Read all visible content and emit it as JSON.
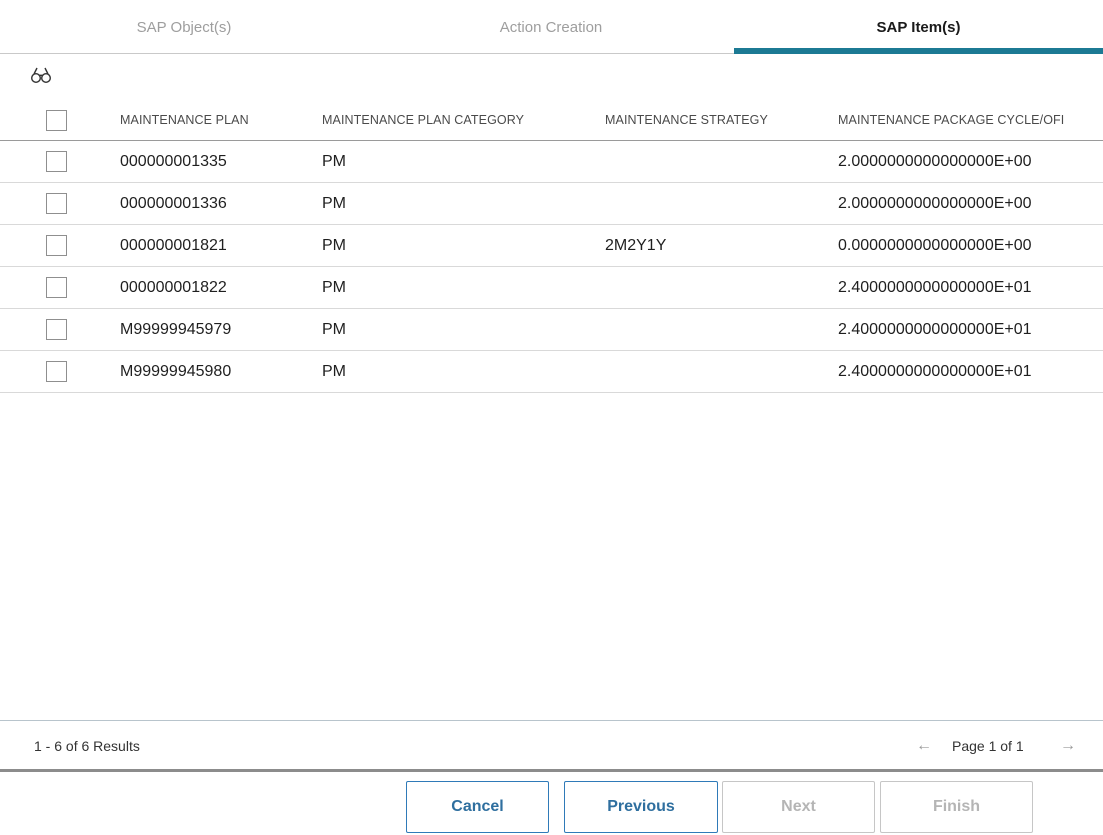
{
  "wizard": {
    "steps": [
      "SAP Object(s)",
      "Action Creation",
      "SAP Item(s)"
    ],
    "active_step": "SAP Item(s)"
  },
  "toolbar": {
    "find_icon": "binoculars-icon"
  },
  "grid": {
    "columns": [
      "MAINTENANCE PLAN",
      "MAINTENANCE PLAN CATEGORY",
      "MAINTENANCE STRATEGY",
      "MAINTENANCE PACKAGE CYCLE/OFI"
    ],
    "rows": [
      [
        "000000001335",
        "PM",
        "",
        "2.0000000000000000E+00"
      ],
      [
        "000000001336",
        "PM",
        "",
        "2.0000000000000000E+00"
      ],
      [
        "000000001821",
        "PM",
        "2M2Y1Y",
        "0.0000000000000000E+00"
      ],
      [
        "000000001822",
        "PM",
        "",
        "2.4000000000000000E+01"
      ],
      [
        "M99999945979",
        "PM",
        "",
        "2.4000000000000000E+01"
      ],
      [
        "M99999945980",
        "PM",
        "",
        "2.4000000000000000E+01"
      ]
    ]
  },
  "pager": {
    "results": "1 - 6 of 6 Results",
    "page_label": "Page 1 of 1",
    "prev_icon": "arrow-left-icon",
    "next_icon": "arrow-right-icon"
  },
  "buttons": {
    "cancel": "Cancel",
    "previous": "Previous",
    "next": "Next",
    "finish": "Finish"
  },
  "colors": {
    "accent": "#1c7a94",
    "button_text": "#2f6f9f",
    "disabled": "#b5b5b5"
  }
}
